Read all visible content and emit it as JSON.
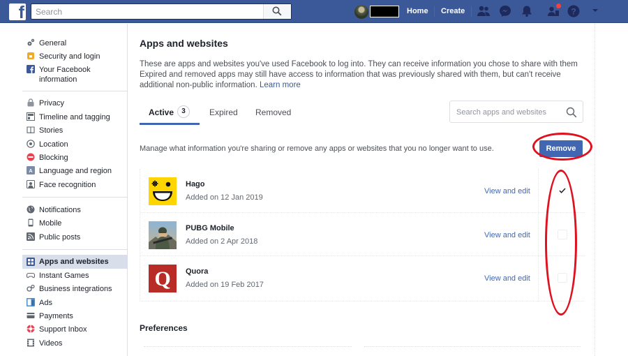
{
  "topbar": {
    "logo_letter": "f",
    "search_placeholder": "Search",
    "home_label": "Home",
    "create_label": "Create",
    "brand_color": "#3b5998",
    "icons": [
      "friends-icon",
      "messenger-icon",
      "bell-icon",
      "friend-requests-icon",
      "help-icon",
      "chevron-down-icon"
    ]
  },
  "sidebar": {
    "groups": [
      [
        {
          "icon": "gear-icon",
          "label": "General"
        },
        {
          "icon": "shield-lock-icon",
          "label": "Security and login"
        },
        {
          "icon": "facebook-icon",
          "label": "Your Facebook information"
        }
      ],
      [
        {
          "icon": "lock-icon",
          "label": "Privacy"
        },
        {
          "icon": "timeline-icon",
          "label": "Timeline and tagging"
        },
        {
          "icon": "book-icon",
          "label": "Stories"
        },
        {
          "icon": "location-icon",
          "label": "Location"
        },
        {
          "icon": "block-icon",
          "label": "Blocking"
        },
        {
          "icon": "language-icon",
          "label": "Language and region"
        },
        {
          "icon": "face-icon",
          "label": "Face recognition"
        }
      ],
      [
        {
          "icon": "globe-icon",
          "label": "Notifications"
        },
        {
          "icon": "mobile-icon",
          "label": "Mobile"
        },
        {
          "icon": "rss-icon",
          "label": "Public posts"
        }
      ],
      [
        {
          "icon": "apps-icon",
          "label": "Apps and websites",
          "active": true
        },
        {
          "icon": "gamepad-icon",
          "label": "Instant Games"
        },
        {
          "icon": "gears-icon",
          "label": "Business integrations"
        },
        {
          "icon": "ads-icon",
          "label": "Ads"
        },
        {
          "icon": "payments-icon",
          "label": "Payments"
        },
        {
          "icon": "lifebuoy-icon",
          "label": "Support Inbox"
        },
        {
          "icon": "film-icon",
          "label": "Videos"
        }
      ]
    ]
  },
  "main": {
    "title": "Apps and websites",
    "description": "These are apps and websites you've used Facebook to log into. They can receive information you chose to share with them Expired and removed apps may still have access to information that was previously shared with them, but can't receive additional non-public information.",
    "learn_more": "Learn more",
    "tabs": [
      {
        "label": "Active",
        "badge": "3",
        "active": true
      },
      {
        "label": "Expired"
      },
      {
        "label": "Removed"
      }
    ],
    "search_placeholder": "Search apps and websites",
    "manage_text": "Manage what information you're sharing or remove any apps or websites that you no longer want to use.",
    "remove_label": "Remove",
    "apps": [
      {
        "name": "Hago",
        "added": "Added on 12 Jan 2019",
        "action": "View and edit",
        "checked": true
      },
      {
        "name": "PUBG Mobile",
        "added": "Added on 2 Apr 2018",
        "action": "View and edit",
        "checked": false
      },
      {
        "name": "Quora",
        "added": "Added on 19 Feb 2017",
        "action": "View and edit",
        "checked": false
      }
    ],
    "preferences_title": "Preferences",
    "annotation_color": "#e0101e"
  }
}
